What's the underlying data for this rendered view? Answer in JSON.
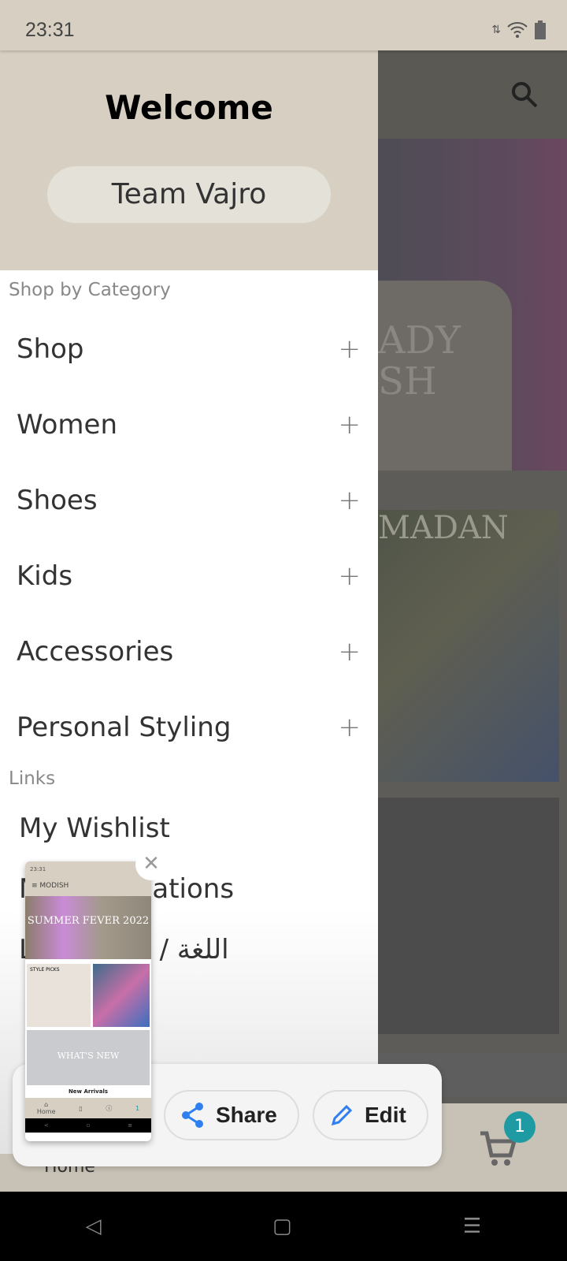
{
  "status_bar": {
    "time": "23:31"
  },
  "drawer": {
    "title": "Welcome",
    "user_button": "Team Vajro",
    "category_section": "Shop by Category",
    "categories": [
      {
        "label": "Shop"
      },
      {
        "label": "Women"
      },
      {
        "label": "Shoes"
      },
      {
        "label": "Kids"
      },
      {
        "label": "Accessories"
      },
      {
        "label": "Personal Styling"
      }
    ],
    "expand_symbol": "+",
    "links_section": "Links",
    "links": [
      {
        "label": "My Wishlist"
      },
      {
        "label": "My Notifications"
      },
      {
        "label": "Language / اللغة"
      }
    ]
  },
  "background": {
    "banner1_text": "ADY\nSH",
    "banner2_text": "MADAN",
    "bottom_nav_home": "Home",
    "cart_badge": "1",
    "accent": "#1d9aa2"
  },
  "screenshot_preview": {
    "time": "23:31",
    "app_name": "MODISH",
    "banner_text": "SUMMER FEVER 2022",
    "tile_text": "STYLE PICKS",
    "new_text": "WHAT'S NEW",
    "caption": "New Arrivals",
    "nav_home": "Home",
    "cart_badge": "1"
  },
  "actions": {
    "share": "Share",
    "edit": "Edit",
    "accent": "#2f7ff0"
  }
}
